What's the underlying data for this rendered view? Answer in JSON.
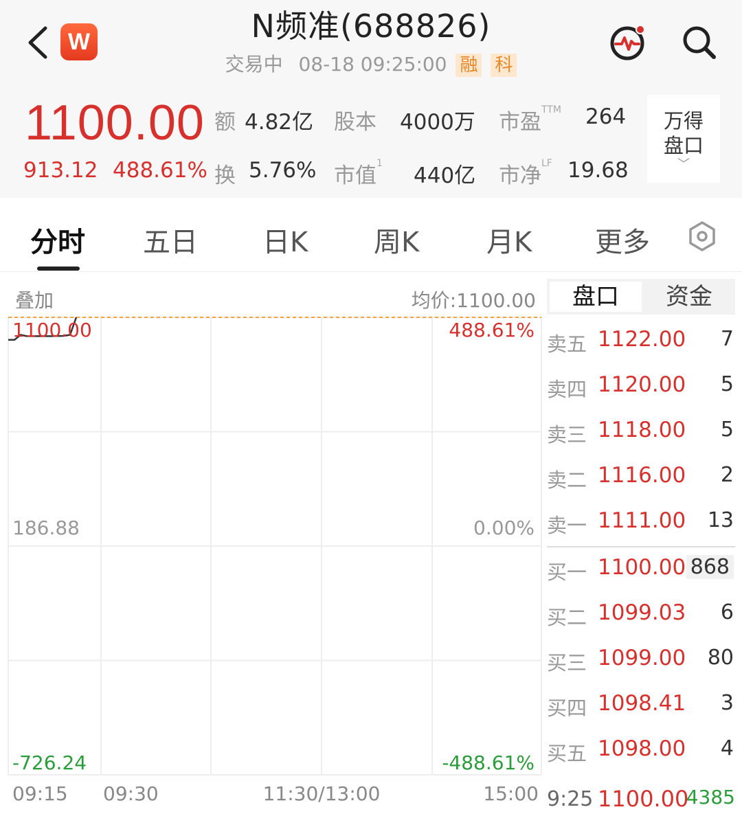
{
  "header": {
    "logo_text": "W",
    "title": "N频准(688826)",
    "status": "交易中",
    "datetime": "08-18 09:25:00",
    "tags": [
      "融",
      "科"
    ]
  },
  "quote": {
    "price": "1100.00",
    "change": "913.12",
    "change_pct": "488.61%",
    "stats": {
      "amount_label": "额",
      "amount": "4.82亿",
      "turnover_label": "换",
      "turnover": "5.76%",
      "share_cap_label": "股本",
      "share_cap": "4000万",
      "mkt_cap_label": "市值",
      "mkt_cap_sup": "1",
      "mkt_cap": "440亿",
      "pe_label": "市盈",
      "pe_sup": "TTM",
      "pe": "264",
      "pb_label": "市净",
      "pb_sup": "LF",
      "pb": "19.68"
    },
    "wande_button": {
      "line1": "万得",
      "line2": "盘口",
      "chevron": "﹀"
    }
  },
  "tabs": [
    {
      "label": "分时",
      "active": true
    },
    {
      "label": "五日",
      "active": false
    },
    {
      "label": "日K",
      "active": false
    },
    {
      "label": "周K",
      "active": false
    },
    {
      "label": "月K",
      "active": false
    },
    {
      "label": "更多",
      "active": false
    }
  ],
  "chart_header": {
    "overlay": "叠加",
    "avg_price": "均价:1100.00"
  },
  "chart_data": {
    "type": "line",
    "y_labels_left": [
      "1100.00",
      "186.88",
      "-726.24"
    ],
    "y_labels_right": [
      "488.61%",
      "0.00%",
      "-488.61%"
    ],
    "x_labels": [
      "09:15",
      "09:30",
      "11:30/13:00",
      "15:00"
    ],
    "ylim": [
      -726.24,
      1100.0
    ],
    "prev_close": 186.88,
    "series": [
      {
        "x": [
          "09:15",
          "09:16",
          "09:17",
          "09:18",
          "09:20",
          "09:22",
          "09:24",
          "09:25",
          "09:26"
        ],
        "values": [
          1010,
          1010,
          1030,
          1025,
          1025,
          1025,
          1026,
          1030,
          1100
        ]
      }
    ],
    "colors": {
      "line": "#333333",
      "avg_line": "#f2a33a",
      "up": "#d7312e",
      "down": "#2a9d3a",
      "grid": "#eeeeee"
    }
  },
  "order_book": {
    "tabs": [
      "盘口",
      "资金"
    ],
    "asks": [
      {
        "label": "卖五",
        "price": "1122.00",
        "vol": "7"
      },
      {
        "label": "卖四",
        "price": "1120.00",
        "vol": "5"
      },
      {
        "label": "卖三",
        "price": "1118.00",
        "vol": "5"
      },
      {
        "label": "卖二",
        "price": "1116.00",
        "vol": "2"
      },
      {
        "label": "卖一",
        "price": "1111.00",
        "vol": "13"
      }
    ],
    "bids": [
      {
        "label": "买一",
        "price": "1100.00",
        "vol": "868"
      },
      {
        "label": "买二",
        "price": "1099.03",
        "vol": "6"
      },
      {
        "label": "买三",
        "price": "1099.00",
        "vol": "80"
      },
      {
        "label": "买四",
        "price": "1098.41",
        "vol": "3"
      },
      {
        "label": "买五",
        "price": "1098.00",
        "vol": "4"
      }
    ],
    "last_trade": {
      "time": "9:25",
      "price": "1100.00",
      "vol": "4385"
    }
  }
}
